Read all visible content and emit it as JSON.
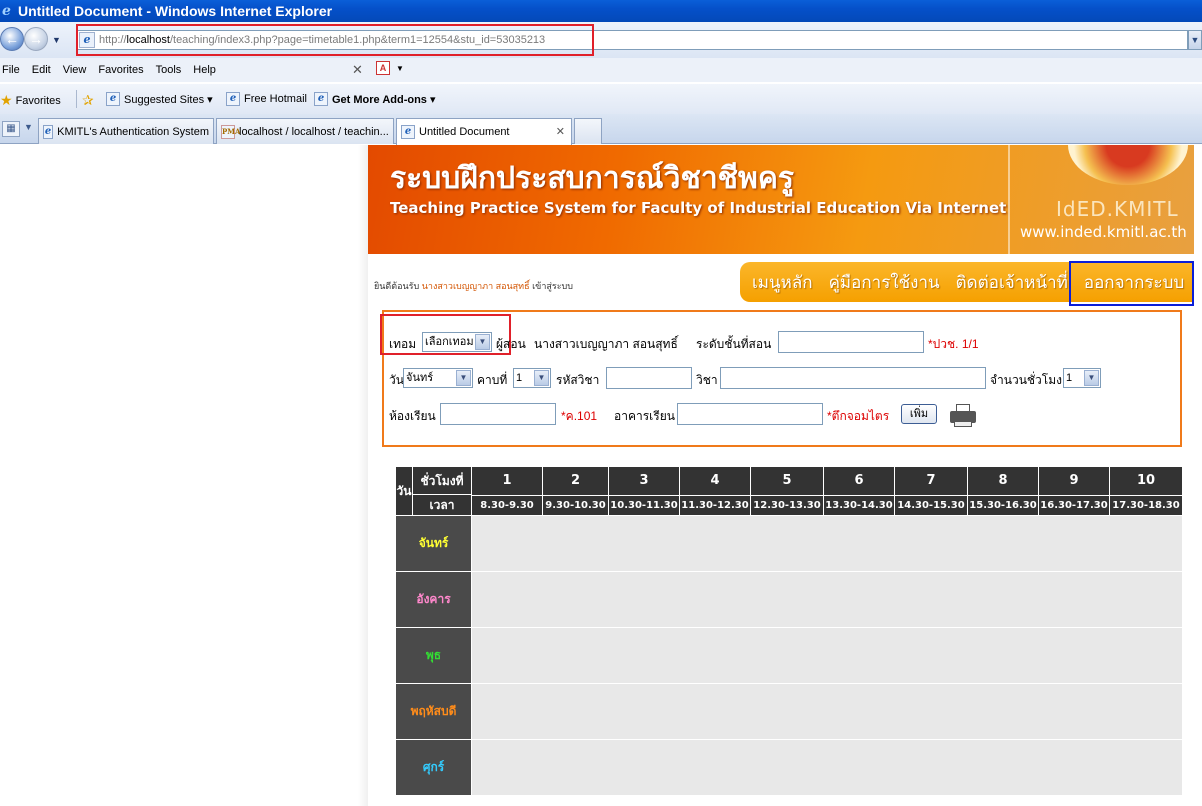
{
  "window": {
    "title": "Untitled Document - Windows Internet Explorer"
  },
  "address": {
    "prefix": "http://",
    "host": "localhost",
    "path": "/teaching/index3.php?page=timetable1.php&term1=12554&stu_id=53035213"
  },
  "menu": [
    "File",
    "Edit",
    "View",
    "Favorites",
    "Tools",
    "Help"
  ],
  "favorites": {
    "label": "Favorites",
    "items": [
      "Suggested Sites ▾",
      "Free Hotmail",
      "Get More Add-ons ▾"
    ]
  },
  "tabs": [
    {
      "label": "KMITL's Authentication System"
    },
    {
      "label": "localhost / localhost / teachin..."
    },
    {
      "label": "Untitled Document"
    }
  ],
  "banner": {
    "title_th": "ระบบฝึกประสบการณ์วิชาชีพครู",
    "title_en": "Teaching Practice System for Faculty of Industrial Education Via Internet",
    "brand": "IdED.KMITL",
    "website": "www.inded.kmitl.ac.th"
  },
  "welcome": {
    "prefix": "ยินดีต้อนรับ",
    "name": "นางสาวเบญญาภา สอนสุทธิ์",
    "suffix": "เข้าสู่ระบบ"
  },
  "nav": {
    "home": "เมนูหลัก",
    "manual": "คู่มือการใช้งาน",
    "contact": "ติดต่อเจ้าหน้าที่",
    "logout": "ออกจากระบบ"
  },
  "form": {
    "term_label": "เทอม",
    "term_value": "เลือกเทอม",
    "teacher_label": "ผู้สอน",
    "teacher_name": "นางสาวเบญญาภา สอนสุทธิ์",
    "level_label": "ระดับชั้นที่สอน",
    "level_hint": "*ปวช. 1/1",
    "day_label": "วัน",
    "day_value": "จันทร์",
    "period_label": "คาบที่",
    "period_value": "1",
    "code_label": "รหัสวิชา",
    "subject_label": "วิชา",
    "hours_label": "จำนวนชั่วโมง",
    "hours_value": "1",
    "room_label": "ห้องเรียน",
    "room_hint": "*ค.101",
    "building_label": "อาคารเรียน",
    "building_hint": "*ตึกจอมไตร",
    "add_button": "เพิ่ม"
  },
  "timetable": {
    "day_header": "วัน",
    "period_header": "ชั่วโมงที่",
    "time_header": "เวลา",
    "periods": [
      "1",
      "2",
      "3",
      "4",
      "5",
      "6",
      "7",
      "8",
      "9",
      "10"
    ],
    "times": [
      "8.30-9.30",
      "9.30-10.30",
      "10.30-11.30",
      "11.30-12.30",
      "12.30-13.30",
      "13.30-14.30",
      "14.30-15.30",
      "15.30-16.30",
      "16.30-17.30",
      "17.30-18.30"
    ],
    "days": [
      {
        "name": "จันทร์",
        "color": "#ffff33"
      },
      {
        "name": "อังคาร",
        "color": "#ff88cc"
      },
      {
        "name": "พุธ",
        "color": "#33dd33"
      },
      {
        "name": "พฤหัสบดี",
        "color": "#ff8c1a"
      },
      {
        "name": "ศุกร์",
        "color": "#33ccff"
      }
    ]
  },
  "colors": {
    "accent_orange": "#f5a000",
    "outline_red": "#e0202a",
    "outline_blue": "#0a1ed8"
  }
}
